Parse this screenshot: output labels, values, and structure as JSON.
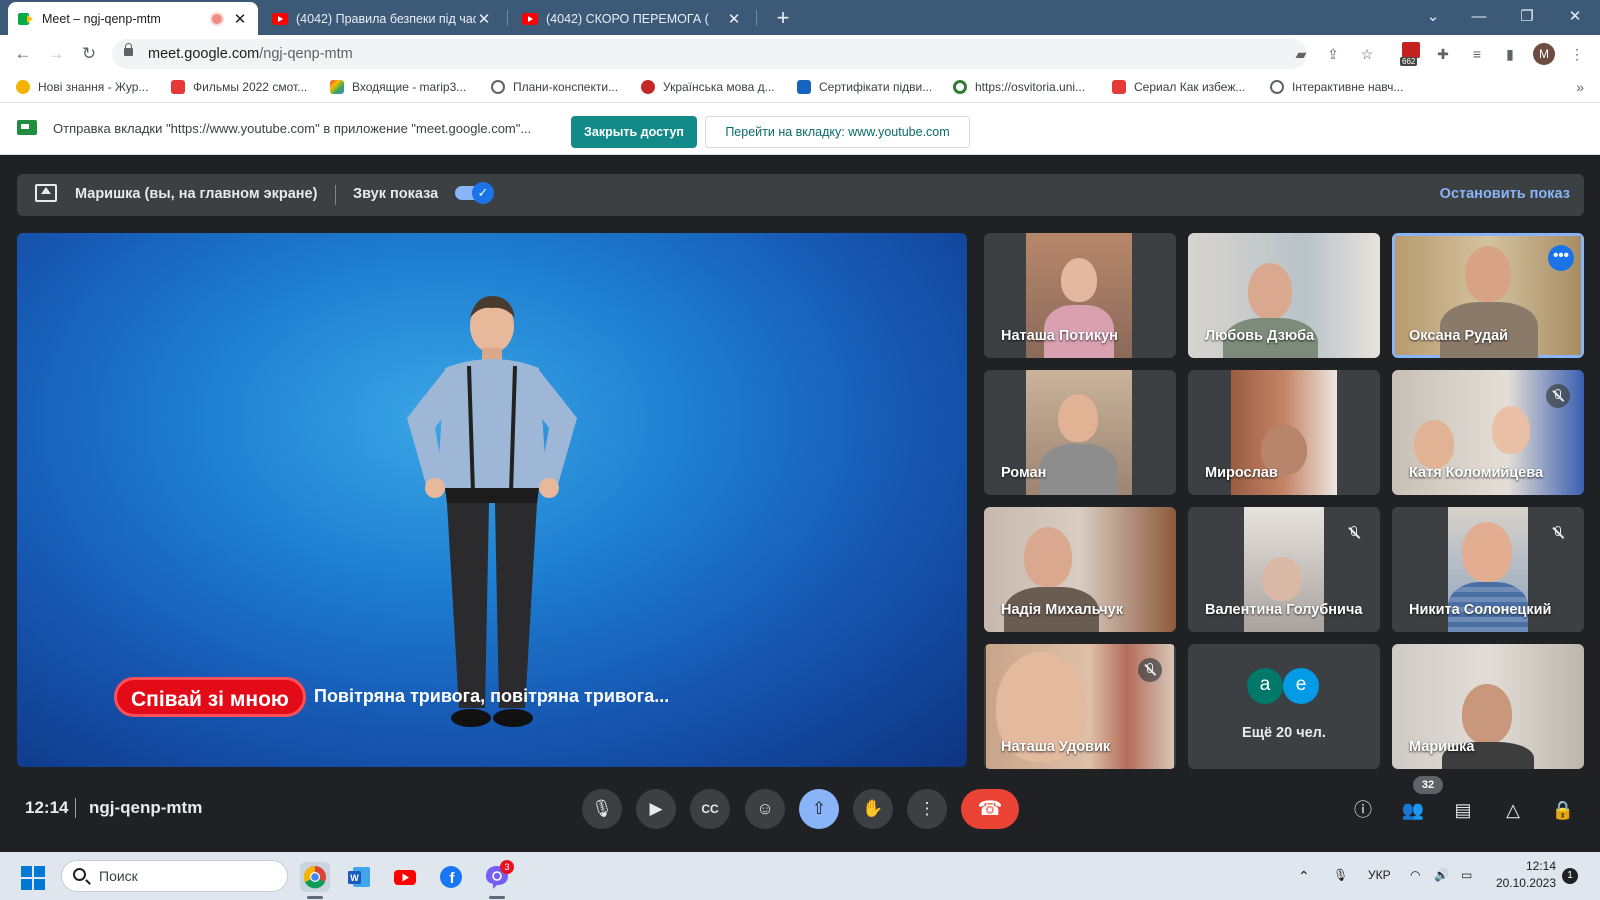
{
  "browser": {
    "tabs": [
      {
        "title": "Meet – ngj-qenp-mtm",
        "icon": "meet-icon",
        "active": true
      },
      {
        "title": "(4042) Правила безпеки під час",
        "icon": "youtube-icon",
        "active": false
      },
      {
        "title": "(4042) СКОРО ПЕРЕМОГА (",
        "icon": "youtube-icon",
        "active": false
      }
    ],
    "url_host": "meet.google.com",
    "url_path": "/ngj-qenp-mtm",
    "profile_initial": "M",
    "extension_badge": "662",
    "bookmarks": [
      {
        "label": "Нові знання - Жур...",
        "color": "#f4b400"
      },
      {
        "label": "Фильмы 2022 смот...",
        "color": "#e53935"
      },
      {
        "label": "Входящие - marip3...",
        "color": "#ea4335"
      },
      {
        "label": "Плани-конспекти...",
        "color": "#5f6368"
      },
      {
        "label": "Українська мова д...",
        "color": "#c62828"
      },
      {
        "label": "Сертифікати підви...",
        "color": "#1565c0"
      },
      {
        "label": "https://osvitoria.uni...",
        "color": "#2e7d32"
      },
      {
        "label": "Сериал Как избеж...",
        "color": "#e53935"
      },
      {
        "label": "Інтерактивне навч...",
        "color": "#5f6368"
      }
    ]
  },
  "infobar": {
    "message": "Отправка вкладки \"https://www.youtube.com\" в приложение \"meet.google.com\"...",
    "close_access": "Закрыть доступ",
    "go_to_tab": "Перейти на вкладку: www.youtube.com"
  },
  "present_bar": {
    "presenter": "Маришка (вы, на главном экране)",
    "sound_label": "Звук показа",
    "sound_enabled": true,
    "stop_label": "Остановить показ"
  },
  "stage": {
    "caption_pill": "Співай зі мною",
    "caption_text": "Повітряна тривога, повітряна тривога..."
  },
  "participants": [
    {
      "name": "Наташа Потикун",
      "muted": false
    },
    {
      "name": "Любовь Дзюба",
      "muted": false
    },
    {
      "name": "Оксана Рудай",
      "muted": false,
      "speaking": true
    },
    {
      "name": "Роман",
      "muted": false
    },
    {
      "name": "Мирослав",
      "muted": false
    },
    {
      "name": "Катя Коломийцева",
      "muted": true
    },
    {
      "name": "Надія Михальчук",
      "muted": false
    },
    {
      "name": "Валентина Голубнича",
      "muted": true
    },
    {
      "name": "Никита Солонецкий",
      "muted": true
    },
    {
      "name": "Наташа Удовик",
      "muted": true
    },
    {
      "name": "Маришка",
      "muted": false
    }
  ],
  "more_tile": {
    "label": "Ещё 20 чел.",
    "avatars": [
      {
        "letter": "a",
        "color": "#00796b"
      },
      {
        "letter": "e",
        "color": "#039be5"
      }
    ]
  },
  "meeting": {
    "time": "12:14",
    "code": "ngj-qenp-mtm",
    "people_count": "32"
  },
  "taskbar": {
    "search_placeholder": "Поиск",
    "chat_badge": "3",
    "language": "УКР",
    "time": "12:14",
    "date": "20.10.2023",
    "notifications": "1"
  }
}
